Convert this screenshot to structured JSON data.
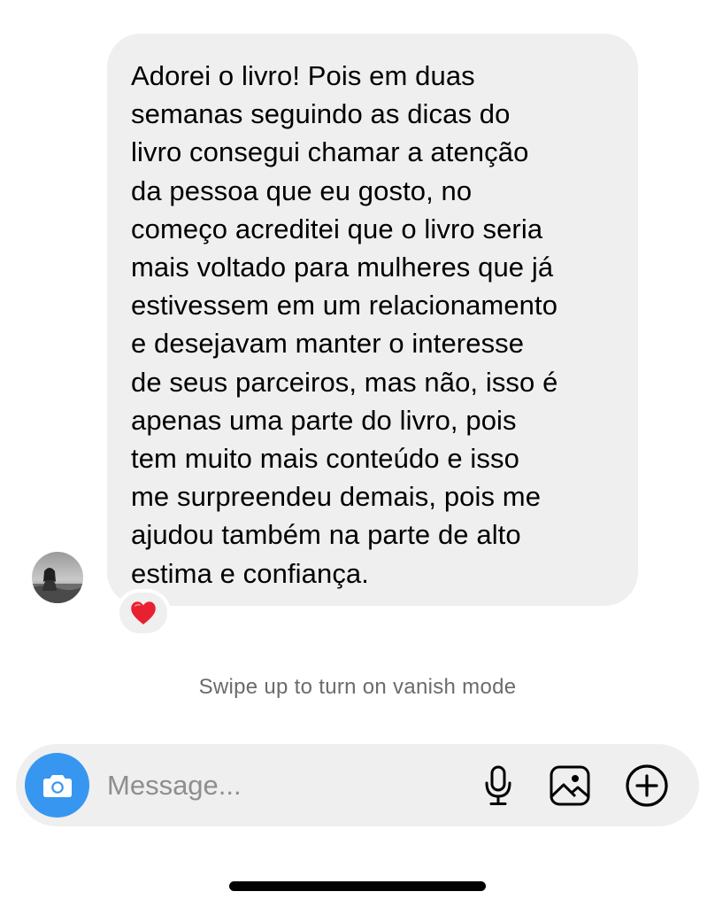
{
  "message": {
    "text": "Adorei o livro! Pois em duas\nsemanas seguindo as dicas do\nlivro consegui chamar a atenção\nda pessoa que eu gosto, no\ncomeço acreditei que o livro seria\nmais voltado para mulheres que já\nestivessem em um relacionamento\ne desejavam manter o interesse\nde seus parceiros, mas não, isso é\napenas uma parte do livro, pois\ntem muito mais conteúdo e isso\nme surpreendeu demais, pois me\najudou também na parte de alto\nestima e confiança.",
    "reaction": "❤️",
    "sender_avatar_icon": "user-avatar-photo"
  },
  "vanish_hint": "Swipe up to turn on vanish mode",
  "composer": {
    "placeholder": "Message...",
    "camera_icon": "camera-icon",
    "mic_icon": "microphone-icon",
    "gallery_icon": "image-gallery-icon",
    "add_icon": "plus-circle-icon"
  },
  "colors": {
    "bubble_bg": "#efefef",
    "camera_button": "#3797f0",
    "hint_text": "#6b6b6b",
    "placeholder_text": "#8e8e8e"
  }
}
